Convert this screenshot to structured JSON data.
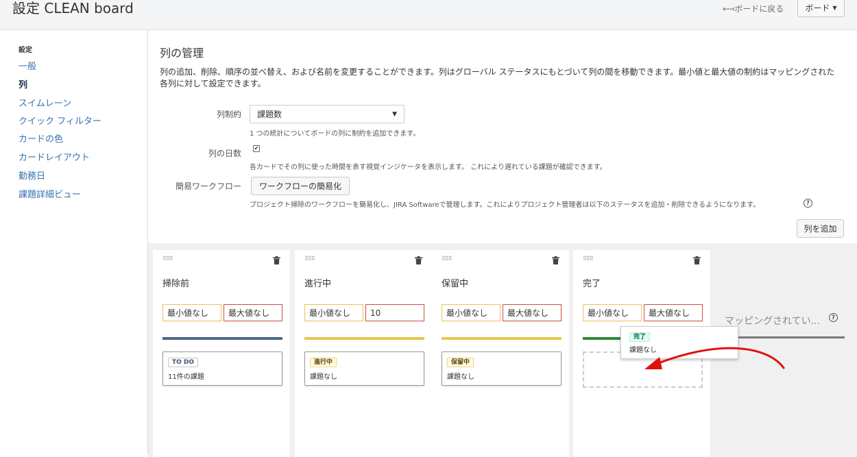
{
  "header": {
    "title": "設定 CLEAN board",
    "back_link": "ボードに戻る",
    "board_button": "ボード"
  },
  "sidebar": {
    "heading": "設定",
    "items": [
      "一般",
      "列",
      "スイムレーン",
      "クイック フィルター",
      "カードの色",
      "カードレイアウト",
      "勤務日",
      "課題詳細ビュー"
    ],
    "active": "列"
  },
  "main": {
    "title": "列の管理",
    "description": "列の追加、削除、順序の並べ替え、および名前を変更することができます。列はグローバル ステータスにもとづいて列の間を移動できます。最小値と最大値の制約はマッピングされた各列に対して設定できます。",
    "constraint": {
      "label": "列制約",
      "value": "課題数",
      "help": "1 つの統計についてボードの列に制約を追加できます。"
    },
    "days_in_column": {
      "label": "列の日数",
      "checked": true,
      "help": "各カードでその列に使った時間を表す視覚インジケータを表示します。 これにより遅れている課題が確認できます。"
    },
    "simplified_workflow": {
      "label": "簡易ワークフロー",
      "button": "ワークフローの簡易化",
      "help": "プロジェクト掃除のワークフローを簡易化し、JIRA Softwareで管理します。これによりプロジェクト管理者は以下のステータスを追加・削除できるようになります。"
    },
    "add_column_button": "列を追加"
  },
  "columns": [
    {
      "name": "掃除前",
      "min": "最小値なし",
      "max": "最大値なし",
      "bar_color": "#4a6785",
      "status": "TO DO",
      "status_style": "todo",
      "count": "11件の課題"
    },
    {
      "name": "進行中",
      "min": "最小値なし",
      "max": "10",
      "bar_color": "#e8c54e",
      "status": "進行中",
      "status_style": "inprogress",
      "count": "課題なし"
    },
    {
      "name": "保留中",
      "min": "最小値なし",
      "max": "最大値なし",
      "bar_color": "#e8c54e",
      "status": "保留中",
      "status_style": "inprogress",
      "count": "課題なし"
    },
    {
      "name": "完了",
      "min": "最小値なし",
      "max": "最大値なし",
      "bar_color": "#2d8a36",
      "status": "",
      "status_style": "done",
      "count": ""
    }
  ],
  "drag_card": {
    "status": "完了",
    "count": "課題なし"
  },
  "unmapped": {
    "title": "マッピングされてい..."
  },
  "colors": {
    "link": "#3572b0",
    "todo": "#4a6785",
    "inprogress": "#e8c54e",
    "done": "#2d8a36",
    "arrow": "#e0120f"
  },
  "icons": [
    "back-arrow-icon",
    "caret-down-icon",
    "grip-icon",
    "trash-icon",
    "help-icon",
    "annotation-arrow-icon"
  ]
}
